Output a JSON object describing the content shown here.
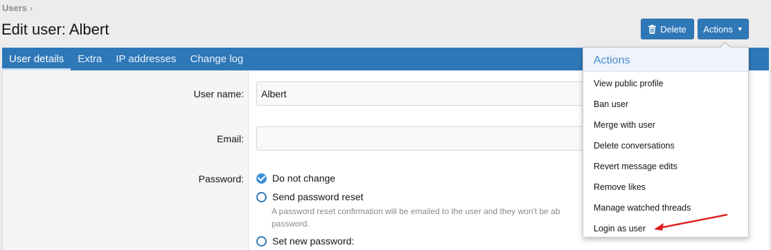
{
  "breadcrumb": {
    "root": "Users",
    "separator": "›"
  },
  "page": {
    "title": "Edit user: Albert"
  },
  "toolbar": {
    "delete_label": "Delete",
    "actions_label": "Actions",
    "delete_icon": "trash-icon",
    "actions_icon": "caret-down-icon"
  },
  "tabs": [
    {
      "label": "User details",
      "active": true
    },
    {
      "label": "Extra"
    },
    {
      "label": "IP addresses"
    },
    {
      "label": "Change log"
    }
  ],
  "form": {
    "username_label": "User name:",
    "username_value": "Albert",
    "email_label": "Email:",
    "email_value": "",
    "password_label": "Password:",
    "password_options": [
      {
        "label": "Do not change",
        "checked": true
      },
      {
        "label": "Send password reset",
        "hint": "A password reset confirmation will be emailed to the user and they won't be ab",
        "hint2": "password."
      },
      {
        "label": "Set new password:"
      }
    ]
  },
  "actions_menu": {
    "title": "Actions",
    "items": [
      "View public profile",
      "Ban user",
      "Merge with user",
      "Delete conversations",
      "Revert message edits",
      "Remove likes",
      "Manage watched threads",
      "Login as user"
    ]
  },
  "colors": {
    "accent": "#2f78b8",
    "annotation_arrow": "#e02020"
  }
}
